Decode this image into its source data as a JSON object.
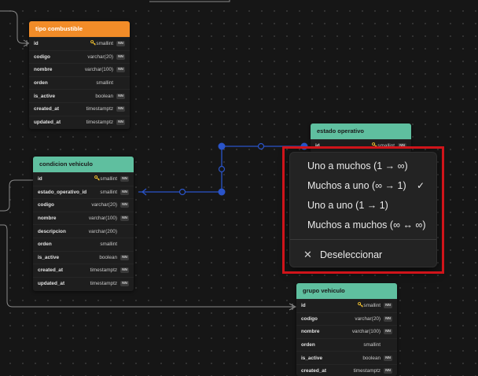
{
  "tables": {
    "tipo_combustible": {
      "title": "tipo combustible",
      "header_color": "#f28c28",
      "rows": [
        {
          "name": "id",
          "type": "smallint",
          "key": true,
          "nn": true
        },
        {
          "name": "codigo",
          "type": "varchar(20)",
          "key": false,
          "nn": true
        },
        {
          "name": "nombre",
          "type": "varchar(100)",
          "key": false,
          "nn": true
        },
        {
          "name": "orden",
          "type": "smallint",
          "key": false,
          "nn": false
        },
        {
          "name": "is_active",
          "type": "boolean",
          "key": false,
          "nn": true
        },
        {
          "name": "created_at",
          "type": "timestamptz",
          "key": false,
          "nn": true
        },
        {
          "name": "updated_at",
          "type": "timestamptz",
          "key": false,
          "nn": true
        }
      ]
    },
    "condicion_vehiculo": {
      "title": "condicion vehiculo",
      "header_color": "#5fbf9f",
      "rows": [
        {
          "name": "id",
          "type": "smallint",
          "key": true,
          "nn": true
        },
        {
          "name": "estado_operativo_id",
          "type": "smallint",
          "key": false,
          "nn": true
        },
        {
          "name": "codigo",
          "type": "varchar(20)",
          "key": false,
          "nn": true
        },
        {
          "name": "nombre",
          "type": "varchar(100)",
          "key": false,
          "nn": true
        },
        {
          "name": "descripcion",
          "type": "varchar(200)",
          "key": false,
          "nn": false
        },
        {
          "name": "orden",
          "type": "smallint",
          "key": false,
          "nn": false
        },
        {
          "name": "is_active",
          "type": "boolean",
          "key": false,
          "nn": true
        },
        {
          "name": "created_at",
          "type": "timestamptz",
          "key": false,
          "nn": true
        },
        {
          "name": "updated_at",
          "type": "timestamptz",
          "key": false,
          "nn": true
        }
      ]
    },
    "estado_operativo": {
      "title": "estado operativo",
      "header_color": "#5fbf9f",
      "rows": [
        {
          "name": "id",
          "type": "smallint",
          "key": true,
          "nn": true
        }
      ]
    },
    "grupo_vehiculo": {
      "title": "grupo vehiculo",
      "header_color": "#5fbf9f",
      "rows": [
        {
          "name": "id",
          "type": "smallint",
          "key": true,
          "nn": true
        },
        {
          "name": "codigo",
          "type": "varchar(20)",
          "key": false,
          "nn": true
        },
        {
          "name": "nombre",
          "type": "varchar(100)",
          "key": false,
          "nn": true
        },
        {
          "name": "orden",
          "type": "smallint",
          "key": false,
          "nn": false
        },
        {
          "name": "is_active",
          "type": "boolean",
          "key": false,
          "nn": true
        },
        {
          "name": "created_at",
          "type": "timestamptz",
          "key": false,
          "nn": true
        }
      ]
    }
  },
  "nn_label": "NN",
  "key_icon": "key-icon",
  "relationship_menu": {
    "items": [
      {
        "label": "Uno a muchos (1 → ∞)",
        "checked": false
      },
      {
        "label": "Muchos a uno (∞ → 1)",
        "checked": true
      },
      {
        "label": "Uno a uno (1 → 1)",
        "checked": false
      },
      {
        "label": "Muchos a muchos (∞ ↔ ∞)",
        "checked": false
      }
    ],
    "check_glyph": "✓",
    "deselect_glyph": "✕",
    "deselect_label": "Deseleccionar"
  },
  "colors": {
    "canvas_bg": "#161616",
    "link_selected": "#2a54c9",
    "link_default": "#8a8a8a",
    "highlight_border": "#d0141a"
  }
}
